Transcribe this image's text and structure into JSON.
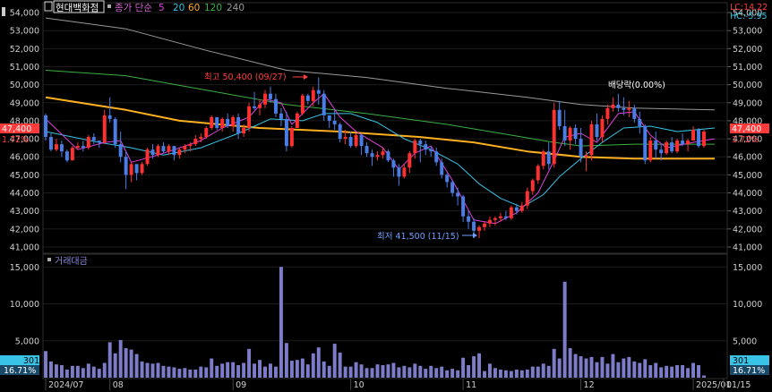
{
  "header": {
    "ticker_name": "현대백화점",
    "ma_label": "종가 단순",
    "ma_periods": [
      {
        "label": "5",
        "color": "#e040e0"
      },
      {
        "label": "20",
        "color": "#39c3e6"
      },
      {
        "label": "60",
        "color": "#ffb020"
      },
      {
        "label": "120",
        "color": "#3cb043"
      },
      {
        "label": "240",
        "color": "#9a9a9a"
      }
    ],
    "lc": "LC:14.22",
    "hc": "HC:-5.95"
  },
  "price_axis": {
    "ticks": [
      "54,000",
      "53,000",
      "52,000",
      "51,000",
      "50,000",
      "49,000",
      "48,000",
      "47,000",
      "46,000",
      "45,000",
      "44,000",
      "43,000",
      "42,000",
      "41,000"
    ],
    "current_value": "47,400",
    "current_pct": "1.72%"
  },
  "volume_panel": {
    "title": "거래대금",
    "ticks": [
      "15,000",
      "10,000",
      "5,000"
    ],
    "current_value": "301",
    "current_pct": "16.71%"
  },
  "x_axis": {
    "labels": [
      "2024/07",
      "08",
      "09",
      "10",
      "11",
      "12",
      "2025/01",
      "01/15"
    ]
  },
  "annotations": {
    "high": "최고 50,400 (09/27)",
    "low": "최저 41,500 (11/15)",
    "dividend": "배당락(0.00%)"
  },
  "colors": {
    "up": "#ff3030",
    "down": "#4a7de6",
    "volume": "#7c7cc9",
    "background": "#000000",
    "grid": "#1c1c1c",
    "current_label": "#ff3b3b",
    "volume_label": "#39c3e6"
  },
  "chart_data": {
    "type": "candlestick",
    "ylim": [
      40800,
      54200
    ],
    "volume_ylim": [
      0,
      16000
    ],
    "candles": [
      [
        48300,
        48400,
        46900,
        47100,
        3600
      ],
      [
        47100,
        47300,
        46300,
        46400,
        2200
      ],
      [
        46400,
        47000,
        46300,
        46700,
        1800
      ],
      [
        46700,
        46900,
        46000,
        46300,
        1700
      ],
      [
        46300,
        46400,
        45700,
        45800,
        1100
      ],
      [
        45800,
        46600,
        45800,
        46500,
        1600
      ],
      [
        46500,
        46800,
        46400,
        46600,
        1600
      ],
      [
        46600,
        46900,
        46300,
        46500,
        1300
      ],
      [
        46500,
        47200,
        46400,
        47100,
        1900
      ],
      [
        47100,
        47300,
        46700,
        46900,
        1500
      ],
      [
        46900,
        46800,
        46500,
        46800,
        1200
      ],
      [
        46800,
        48600,
        46700,
        48300,
        2000
      ],
      [
        48300,
        49300,
        47900,
        48100,
        4800
      ],
      [
        48100,
        48200,
        46500,
        46700,
        3300
      ],
      [
        46700,
        47400,
        45700,
        46000,
        5100
      ],
      [
        46000,
        46300,
        44200,
        45000,
        4000
      ],
      [
        45000,
        45700,
        44600,
        45600,
        3800
      ],
      [
        45600,
        45400,
        44700,
        45100,
        3200
      ],
      [
        45100,
        45700,
        45000,
        45600,
        2200
      ],
      [
        45600,
        46500,
        45500,
        46400,
        2000
      ],
      [
        46400,
        46700,
        45900,
        46100,
        1900
      ],
      [
        46100,
        46700,
        46000,
        46600,
        2000
      ],
      [
        46600,
        46800,
        46200,
        46300,
        1600
      ],
      [
        46300,
        46700,
        46100,
        46600,
        1500
      ],
      [
        46600,
        46600,
        45800,
        46100,
        1400
      ],
      [
        46100,
        46500,
        45900,
        46400,
        1200
      ],
      [
        46400,
        46700,
        46200,
        46600,
        1300
      ],
      [
        46600,
        46800,
        46300,
        46700,
        1100
      ],
      [
        46700,
        47200,
        46600,
        47000,
        1100
      ],
      [
        47000,
        47300,
        46800,
        47100,
        1500
      ],
      [
        47100,
        47700,
        47000,
        47600,
        1400
      ],
      [
        47600,
        48300,
        47500,
        48200,
        2600
      ],
      [
        48200,
        48200,
        47500,
        47600,
        1600
      ],
      [
        47600,
        48200,
        47400,
        48100,
        1900
      ],
      [
        48100,
        48400,
        47600,
        47700,
        2100
      ],
      [
        47700,
        48300,
        47400,
        48200,
        2100
      ],
      [
        48200,
        48400,
        47000,
        47300,
        1700
      ],
      [
        47300,
        47800,
        47100,
        47600,
        2000
      ],
      [
        47600,
        49000,
        47400,
        48800,
        3900
      ],
      [
        48800,
        49600,
        48600,
        48700,
        1900
      ],
      [
        48700,
        49200,
        48300,
        48900,
        2400
      ],
      [
        48900,
        49700,
        48700,
        49500,
        1500
      ],
      [
        49500,
        49900,
        49000,
        49200,
        1900
      ],
      [
        49200,
        49500,
        48200,
        48400,
        1500
      ],
      [
        48400,
        48700,
        47700,
        48100,
        15000
      ],
      [
        48100,
        48500,
        46300,
        46600,
        4700
      ],
      [
        46600,
        47700,
        46500,
        47600,
        2300
      ],
      [
        47600,
        48500,
        47600,
        48400,
        2400
      ],
      [
        48400,
        49500,
        48300,
        49400,
        2600
      ],
      [
        49400,
        49500,
        48900,
        49100,
        1800
      ],
      [
        49100,
        49900,
        48800,
        49700,
        3300
      ],
      [
        49700,
        50400,
        48900,
        49500,
        4100
      ],
      [
        49500,
        49700,
        48000,
        48300,
        2200
      ],
      [
        48300,
        48300,
        47600,
        48000,
        1600
      ],
      [
        48000,
        48600,
        47500,
        47800,
        4600
      ],
      [
        47800,
        47900,
        46800,
        47000,
        3400
      ],
      [
        47000,
        47500,
        46700,
        47100,
        1500
      ],
      [
        47100,
        47400,
        46500,
        46600,
        1500
      ],
      [
        46600,
        47300,
        46500,
        47200,
        2100
      ],
      [
        47200,
        47300,
        46100,
        46600,
        1800
      ],
      [
        46600,
        46800,
        46000,
        46200,
        1300
      ],
      [
        46200,
        46400,
        45500,
        46000,
        1300
      ],
      [
        46000,
        46300,
        45800,
        46100,
        1800
      ],
      [
        46100,
        46500,
        45900,
        46300,
        1700
      ],
      [
        46300,
        46400,
        45700,
        45800,
        1800
      ],
      [
        45800,
        45900,
        44900,
        45400,
        2000
      ],
      [
        45400,
        45600,
        44400,
        44900,
        1400
      ],
      [
        44900,
        45600,
        44800,
        45400,
        1600
      ],
      [
        45400,
        46300,
        45100,
        46200,
        1400
      ],
      [
        46200,
        47000,
        45900,
        46900,
        1900
      ],
      [
        46900,
        47000,
        45700,
        46700,
        1600
      ],
      [
        46700,
        46900,
        46100,
        46400,
        1200
      ],
      [
        46400,
        46600,
        46000,
        46300,
        1600
      ],
      [
        46300,
        46500,
        45500,
        45700,
        1300
      ],
      [
        45700,
        45900,
        44800,
        45000,
        1500
      ],
      [
        45000,
        45100,
        44300,
        44600,
        1000
      ],
      [
        44600,
        44700,
        43800,
        44000,
        1200
      ],
      [
        44000,
        44300,
        43300,
        43800,
        1000
      ],
      [
        43800,
        43900,
        42400,
        42700,
        2700
      ],
      [
        42700,
        43000,
        42000,
        42400,
        1700
      ],
      [
        42400,
        42600,
        41500,
        41900,
        2900
      ],
      [
        41900,
        42200,
        41500,
        42100,
        3300
      ],
      [
        42100,
        42400,
        41900,
        42300,
        900
      ],
      [
        42300,
        42700,
        42100,
        42500,
        1900
      ],
      [
        42500,
        42700,
        42200,
        42600,
        1300
      ],
      [
        42600,
        42900,
        42400,
        42700,
        1100
      ],
      [
        42700,
        43000,
        42500,
        42600,
        1000
      ],
      [
        42600,
        43300,
        42500,
        43200,
        900
      ],
      [
        43200,
        43400,
        42800,
        43000,
        1100
      ],
      [
        43000,
        43500,
        42900,
        43300,
        1000
      ],
      [
        43300,
        44300,
        43100,
        44100,
        1100
      ],
      [
        44100,
        44800,
        43900,
        44700,
        1500
      ],
      [
        44700,
        45600,
        44500,
        45500,
        1500
      ],
      [
        45500,
        46400,
        45300,
        46300,
        1900
      ],
      [
        46300,
        46800,
        45300,
        45600,
        1600
      ],
      [
        45600,
        49000,
        45400,
        48600,
        3900
      ],
      [
        48600,
        49100,
        47500,
        47700,
        2600
      ],
      [
        47700,
        48600,
        46600,
        46900,
        13000
      ],
      [
        46900,
        47700,
        46400,
        47600,
        4000
      ],
      [
        47600,
        47800,
        46700,
        47000,
        3200
      ],
      [
        47000,
        47600,
        45700,
        46000,
        2900
      ],
      [
        46000,
        46300,
        45200,
        46100,
        2600
      ],
      [
        46100,
        48000,
        45800,
        47800,
        2800
      ],
      [
        47800,
        48400,
        46900,
        47100,
        2100
      ],
      [
        47100,
        48300,
        46800,
        48100,
        2800
      ],
      [
        48100,
        48900,
        47800,
        48700,
        1900
      ],
      [
        48700,
        49300,
        48500,
        48900,
        3200
      ],
      [
        48900,
        49500,
        48500,
        48700,
        2100
      ],
      [
        48700,
        49300,
        48300,
        48600,
        2600
      ],
      [
        48600,
        49100,
        48200,
        48700,
        2800
      ],
      [
        48700,
        48900,
        47900,
        48100,
        2200
      ],
      [
        48100,
        48500,
        47300,
        47700,
        2000
      ],
      [
        47700,
        47800,
        45600,
        45800,
        2500
      ],
      [
        45800,
        47100,
        45700,
        46900,
        1700
      ],
      [
        46900,
        47400,
        45900,
        46400,
        2000
      ],
      [
        46400,
        46700,
        45800,
        46200,
        1400
      ],
      [
        46200,
        46900,
        46100,
        46800,
        1600
      ],
      [
        46800,
        47100,
        46200,
        46300,
        1500
      ],
      [
        46300,
        47000,
        46200,
        46900,
        1700
      ],
      [
        46900,
        47300,
        46600,
        46700,
        1700
      ],
      [
        46700,
        47000,
        46300,
        46900,
        1300
      ],
      [
        46900,
        47700,
        46900,
        47500,
        2000
      ],
      [
        47500,
        47600,
        46500,
        46600,
        1700
      ],
      [
        46600,
        47500,
        46500,
        47400,
        301
      ]
    ],
    "ma5": [
      [
        0,
        48100
      ],
      [
        6,
        46400
      ],
      [
        11,
        46800
      ],
      [
        14,
        46900
      ],
      [
        16,
        45700
      ],
      [
        21,
        46100
      ],
      [
        29,
        46900
      ],
      [
        33,
        47600
      ],
      [
        38,
        48200
      ],
      [
        41,
        49200
      ],
      [
        44,
        49000
      ],
      [
        46,
        47800
      ],
      [
        50,
        49000
      ],
      [
        52,
        49500
      ],
      [
        55,
        48200
      ],
      [
        58,
        47400
      ],
      [
        63,
        46500
      ],
      [
        66,
        45300
      ],
      [
        69,
        46200
      ],
      [
        72,
        46600
      ],
      [
        76,
        44700
      ],
      [
        80,
        42500
      ],
      [
        84,
        42300
      ],
      [
        88,
        42900
      ],
      [
        92,
        44000
      ],
      [
        95,
        45800
      ],
      [
        97,
        47100
      ],
      [
        100,
        47300
      ],
      [
        103,
        46800
      ],
      [
        107,
        48400
      ],
      [
        110,
        48500
      ],
      [
        113,
        47200
      ],
      [
        116,
        46500
      ],
      [
        121,
        46800
      ],
      [
        125,
        47000
      ]
    ],
    "ma20": [
      [
        0,
        47400
      ],
      [
        10,
        46800
      ],
      [
        16,
        46500
      ],
      [
        22,
        46100
      ],
      [
        29,
        46500
      ],
      [
        36,
        47300
      ],
      [
        42,
        48100
      ],
      [
        48,
        48000
      ],
      [
        52,
        48400
      ],
      [
        57,
        48400
      ],
      [
        62,
        47900
      ],
      [
        67,
        47000
      ],
      [
        72,
        46400
      ],
      [
        77,
        45600
      ],
      [
        81,
        44500
      ],
      [
        85,
        43700
      ],
      [
        89,
        43200
      ],
      [
        93,
        43900
      ],
      [
        96,
        44900
      ],
      [
        100,
        45900
      ],
      [
        104,
        46800
      ],
      [
        108,
        47600
      ],
      [
        113,
        47700
      ],
      [
        118,
        47400
      ],
      [
        125,
        47600
      ]
    ],
    "ma60": [
      [
        0,
        49300
      ],
      [
        15,
        48600
      ],
      [
        25,
        48000
      ],
      [
        40,
        47600
      ],
      [
        55,
        47400
      ],
      [
        70,
        47100
      ],
      [
        80,
        46800
      ],
      [
        90,
        46300
      ],
      [
        100,
        46000
      ],
      [
        110,
        45900
      ],
      [
        116,
        45900
      ],
      [
        125,
        45900
      ]
    ],
    "ma120": [
      [
        0,
        50800
      ],
      [
        15,
        50500
      ],
      [
        30,
        49700
      ],
      [
        45,
        48900
      ],
      [
        60,
        48400
      ],
      [
        75,
        47800
      ],
      [
        85,
        47300
      ],
      [
        95,
        46800
      ],
      [
        100,
        46600
      ],
      [
        110,
        46700
      ],
      [
        125,
        46700
      ]
    ],
    "ma240": [
      [
        0,
        53700
      ],
      [
        15,
        53100
      ],
      [
        30,
        51900
      ],
      [
        45,
        50800
      ],
      [
        60,
        50400
      ],
      [
        75,
        49800
      ],
      [
        90,
        49300
      ],
      [
        100,
        48900
      ],
      [
        110,
        48700
      ],
      [
        125,
        48600
      ]
    ]
  }
}
